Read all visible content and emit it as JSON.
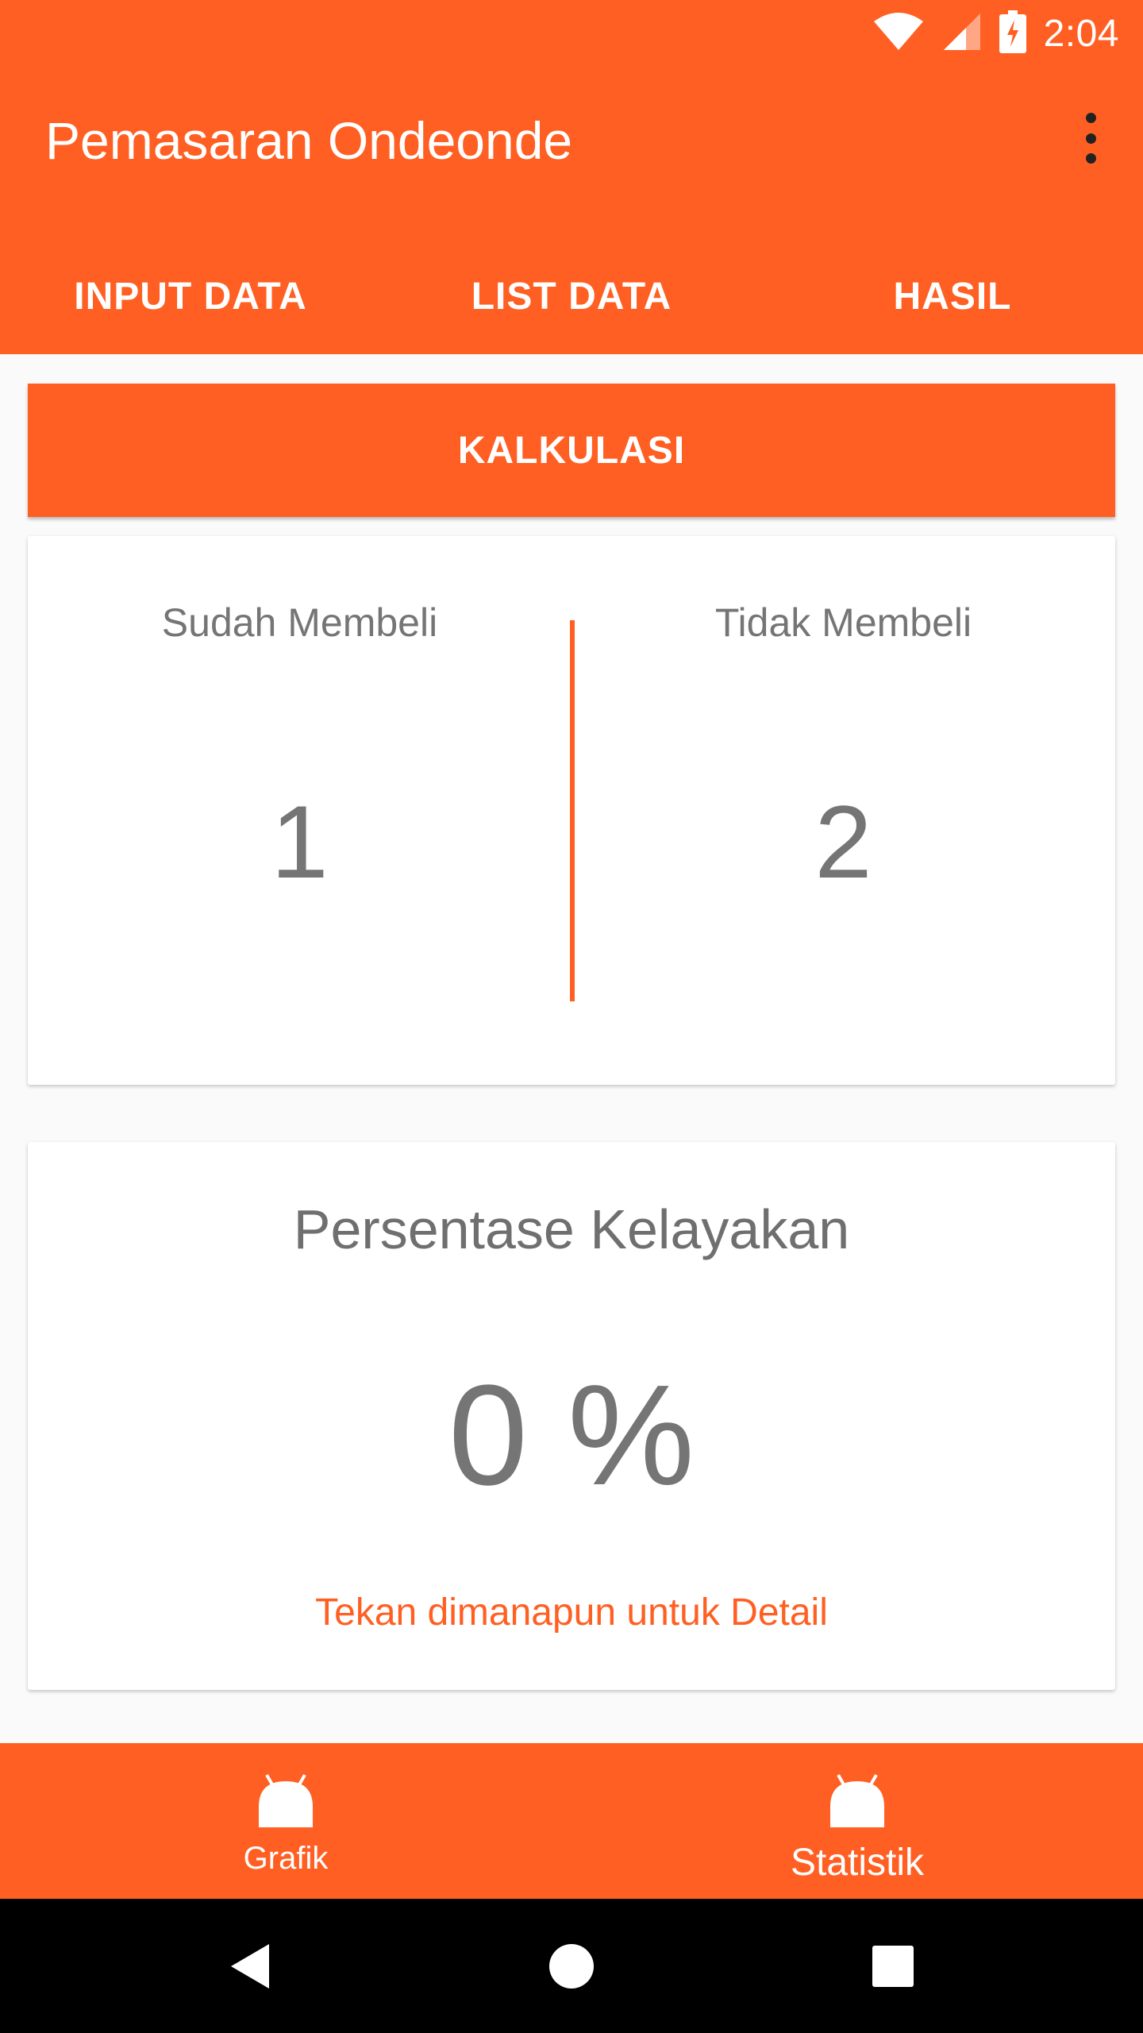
{
  "status_bar": {
    "time": "2:04",
    "icons": [
      "wifi-icon",
      "signal-icon",
      "battery-charging-icon"
    ]
  },
  "app_bar": {
    "title": "Pemasaran Ondeonde",
    "menu_icon": "more-vert-icon"
  },
  "tabs": [
    {
      "label": "INPUT DATA"
    },
    {
      "label": "LIST DATA"
    },
    {
      "label": "HASIL"
    }
  ],
  "main": {
    "calculate_button": "KALKULASI",
    "summary": {
      "bought_label": "Sudah Membeli",
      "bought_value": "1",
      "not_bought_label": "Tidak Membeli",
      "not_bought_value": "2"
    },
    "percentage": {
      "title": "Persentase Kelayakan",
      "value": "0 %",
      "hint": "Tekan dimanapun untuk Detail"
    }
  },
  "bottom_nav": [
    {
      "label": "Grafik",
      "icon": "android-icon"
    },
    {
      "label": "Statistik",
      "icon": "android-icon"
    }
  ],
  "system_nav": [
    "back-icon",
    "home-icon",
    "recents-icon"
  ],
  "colors": {
    "accent": "#FF5F22",
    "text_gray": "#757575",
    "background": "#FAFAFA"
  }
}
